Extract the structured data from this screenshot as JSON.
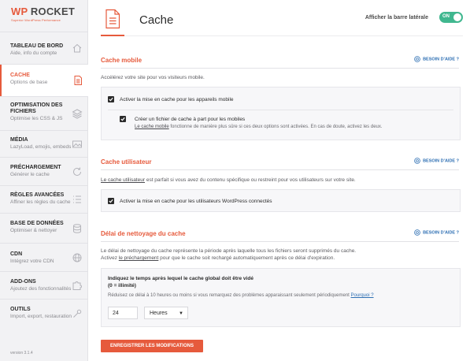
{
  "app": {
    "logo_brand_wp": "WP",
    "logo_brand_name": "ROCKET",
    "logo_tagline": "Superior WordPress Performance",
    "version": "version 3.1.4"
  },
  "sidebar": {
    "items": [
      {
        "title": "TABLEAU DE BORD",
        "sub": "Aide, info du compte",
        "icon": "home-icon"
      },
      {
        "title": "CACHE",
        "sub": "Options de base",
        "icon": "cache-file-icon",
        "active": true
      },
      {
        "title": "OPTIMISATION DES FICHIERS",
        "sub": "Optimise les CSS & JS",
        "icon": "layers-icon"
      },
      {
        "title": "MÉDIA",
        "sub": "LazyLoad, emojis, embeds",
        "icon": "image-icon"
      },
      {
        "title": "PRÉCHARGEMENT",
        "sub": "Générer le cache",
        "icon": "refresh-icon"
      },
      {
        "title": "RÈGLES AVANCÉES",
        "sub": "Affiner les règles du cache",
        "icon": "list-icon"
      },
      {
        "title": "BASE DE DONNÉES",
        "sub": "Optimiser & nettoyer",
        "icon": "database-icon"
      },
      {
        "title": "CDN",
        "sub": "Intégrez votre CDN",
        "icon": "globe-icon"
      },
      {
        "title": "ADD-ONS",
        "sub": "Ajoutez des fonctionnalités",
        "icon": "puzzle-icon"
      },
      {
        "title": "OUTILS",
        "sub": "Import, export, restauration",
        "icon": "tools-icon"
      }
    ]
  },
  "header": {
    "title": "Cache",
    "sidebar_toggle_label": "Afficher la barre latérale",
    "toggle_state": "ON"
  },
  "help_label": "BESOIN D'AIDE ?",
  "cache_mobile": {
    "title": "Cache mobile",
    "description": "Accélérez votre site pour vos visiteurs mobile.",
    "opt1_label": "Activer la mise en cache pour les appareils mobile",
    "opt2_label": "Créer un fichier de cache à part pour les mobiles",
    "opt2_help_link": "Le cache mobile",
    "opt2_help_rest": "fonctionne de manière plus sûre si ces deux options sont activées. En cas de doute, activez les deux."
  },
  "cache_user": {
    "title": "Cache utilisateur",
    "desc_link": "Le cache utilisateur",
    "desc_rest": "est parfait si vous avez du contenu spécifique ou restreint pour vos utilisateurs sur votre site.",
    "opt_label": "Activer la mise en cache pour les utilisateurs WordPress connectés"
  },
  "cleanup": {
    "title": "Délai de nettoyage du cache",
    "desc_line1": "Le délai de nettoyage du cache représente la période après laquelle tous les fichiers seront supprimés du cache.",
    "desc_line2_prefix": "Activez",
    "desc_line2_link": "le préchargement",
    "desc_line2_rest": "pour que le cache soit rechargé automatiquement après ce délai d'expiration.",
    "field_label": "Indiquez le temps après lequel le cache global doit être vidé",
    "field_hint": "(0 = illimité)",
    "field_note": "Réduisez ce délai à 10 heures ou moins si vous remarquez des problèmes apparaissant seulement périodiquement",
    "field_note_link": "Pourquoi ?",
    "value": "24",
    "unit": "Heures"
  },
  "save_button": "ENREGISTRER LES MODIFICATIONS",
  "colors": {
    "accent": "#e65a3c",
    "toggle_on": "#40b78f",
    "help_link": "#2e6fb3"
  }
}
